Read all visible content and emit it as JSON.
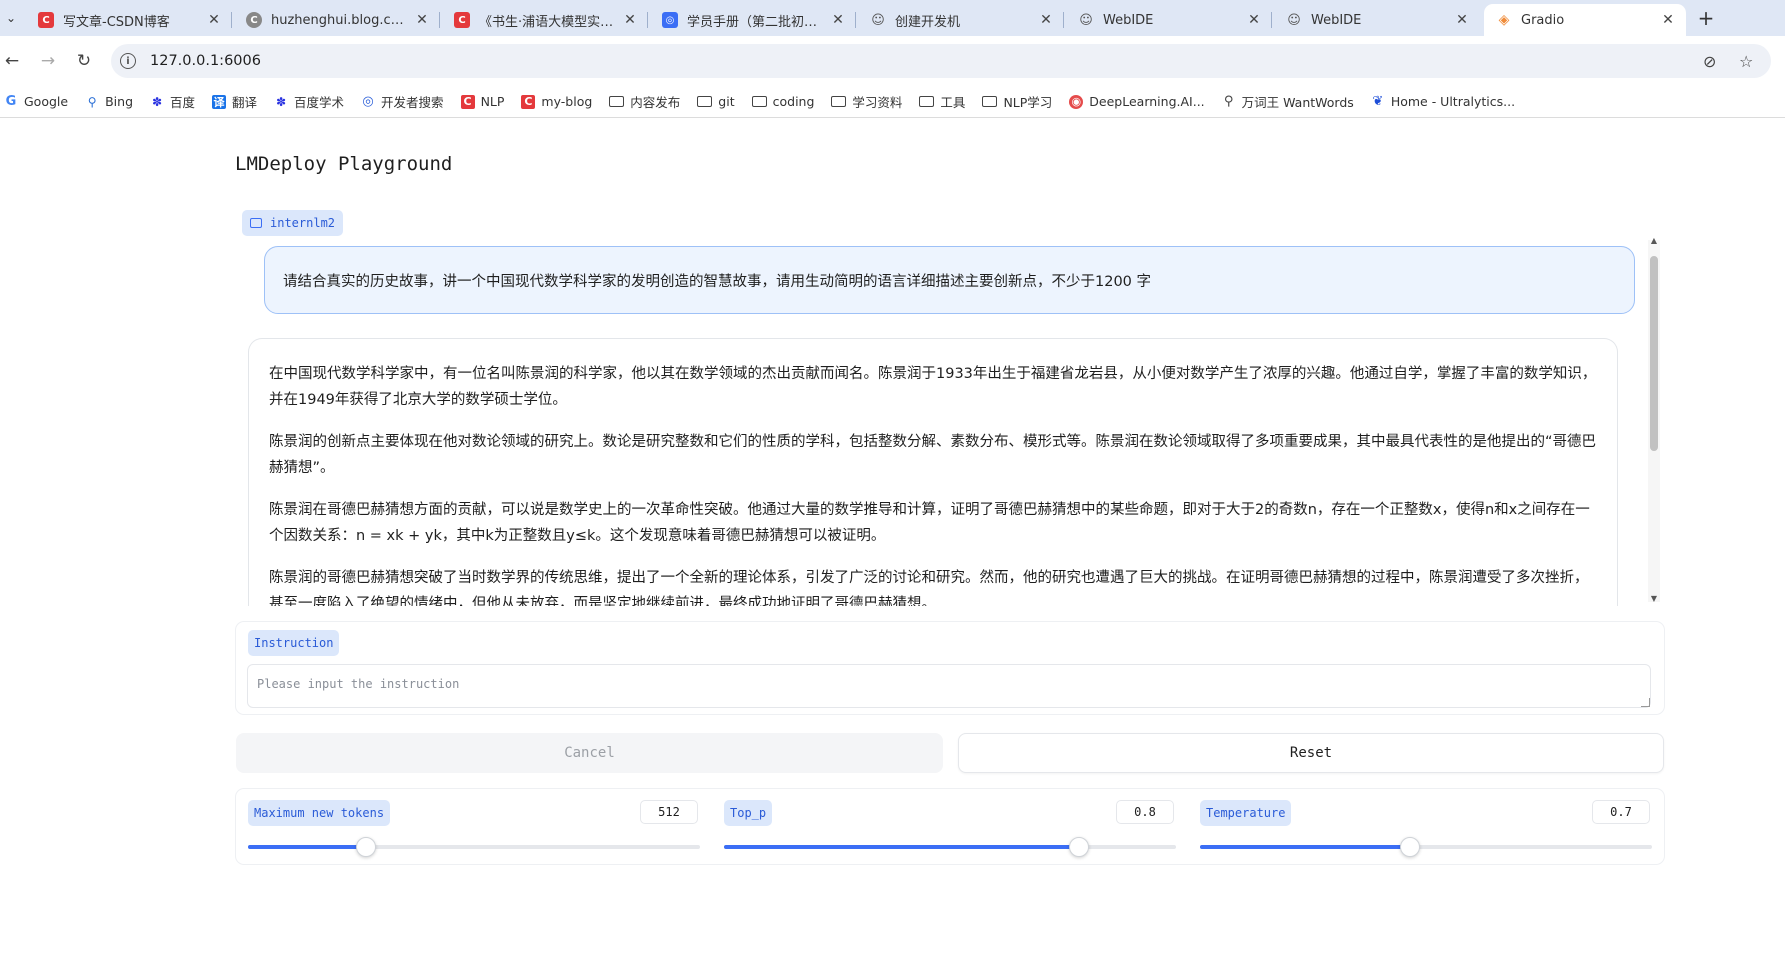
{
  "browser": {
    "tabs": [
      {
        "title": "写文章-CSDN博客",
        "favicon": "csdn-icon",
        "active": false
      },
      {
        "title": "huzhenghui.blog.csdn.n",
        "favicon": "page-icon",
        "active": false
      },
      {
        "title": "《书生·浦语大模型实战营",
        "favicon": "csdn-icon",
        "active": false
      },
      {
        "title": "学员手册（第二批初夏专",
        "favicon": "doc-icon",
        "active": false
      },
      {
        "title": "创建开发机",
        "favicon": "ide-icon",
        "active": false
      },
      {
        "title": "WebIDE",
        "favicon": "ide-icon",
        "active": false
      },
      {
        "title": "WebIDE",
        "favicon": "ide-icon",
        "active": false
      },
      {
        "title": "Gradio",
        "favicon": "gradio-icon",
        "active": true
      }
    ],
    "url": "127.0.0.1:6006",
    "bookmarks": [
      {
        "label": "Google",
        "icon": "google-icon"
      },
      {
        "label": "Bing",
        "icon": "bing-icon"
      },
      {
        "label": "百度",
        "icon": "baidu-icon"
      },
      {
        "label": "翻译",
        "icon": "translate-icon"
      },
      {
        "label": "百度学术",
        "icon": "baidu-icon"
      },
      {
        "label": "开发者搜索",
        "icon": "dev-search-icon"
      },
      {
        "label": "NLP",
        "icon": "csdn-icon"
      },
      {
        "label": "my-blog",
        "icon": "csdn-icon"
      },
      {
        "label": "内容发布",
        "icon": "folder-icon"
      },
      {
        "label": "git",
        "icon": "folder-icon"
      },
      {
        "label": "coding",
        "icon": "folder-icon"
      },
      {
        "label": "学习资料",
        "icon": "folder-icon"
      },
      {
        "label": "工具",
        "icon": "folder-icon"
      },
      {
        "label": "NLP学习",
        "icon": "folder-icon"
      },
      {
        "label": "DeepLearning.AI...",
        "icon": "deeplearning-icon"
      },
      {
        "label": "万词王 WantWords",
        "icon": "wantwords-icon"
      },
      {
        "label": "Home - Ultralytics...",
        "icon": "ultralytics-icon"
      }
    ]
  },
  "app": {
    "title": "LMDeploy Playground",
    "model_name": "internlm2",
    "user_message": "请结合真实的历史故事，讲一个中国现代数学科学家的发明创造的智慧故事，请用生动简明的语言详细描述主要创新点，不少于1200 字",
    "bot_paragraphs": [
      "在中国现代数学科学家中，有一位名叫陈景润的科学家，他以其在数学领域的杰出贡献而闻名。陈景润于1933年出生于福建省龙岩县，从小便对数学产生了浓厚的兴趣。他通过自学，掌握了丰富的数学知识，并在1949年获得了北京大学的数学硕士学位。",
      "陈景润的创新点主要体现在他对数论领域的研究上。数论是研究整数和它们的性质的学科，包括整数分解、素数分布、模形式等。陈景润在数论领域取得了多项重要成果，其中最具代表性的是他提出的“哥德巴赫猜想”。",
      "陈景润在哥德巴赫猜想方面的贡献，可以说是数学史上的一次革命性突破。他通过大量的数学推导和计算，证明了哥德巴赫猜想中的某些命题，即对于大于2的奇数n，存在一个正整数x，使得n和x之间存在一个因数关系：n = xk + yk，其中k为正整数且y≤k。这个发现意味着哥德巴赫猜想可以被证明。",
      "陈景润的哥德巴赫猜想突破了当时数学界的传统思维，提出了一个全新的理论体系，引发了广泛的讨论和研究。然而，他的研究也遭遇了巨大的挑战。在证明哥德巴赫猜想的过程中，陈景润遭受了多次挫折，甚至一度陷入了绝望的情绪中，但他从未放弃，而是坚定地继续前进，最终成功地证明了哥德巴赫猜想。"
    ],
    "instruction": {
      "label": "Instruction",
      "placeholder": "Please input the instruction",
      "value": ""
    },
    "buttons": {
      "cancel": "Cancel",
      "reset": "Reset"
    },
    "sliders": [
      {
        "label": "Maximum new tokens",
        "value": "512",
        "fraction": 0.26
      },
      {
        "label": "Top_p",
        "value": "0.8",
        "fraction": 0.786
      },
      {
        "label": "Temperature",
        "value": "0.7",
        "fraction": 0.465
      }
    ]
  },
  "colors": {
    "accent": "#3b6ef5",
    "chip_bg": "#dbe7fb",
    "user_bubble_bg": "#edf4fe",
    "tabstrip_bg": "#dfe7f5"
  }
}
